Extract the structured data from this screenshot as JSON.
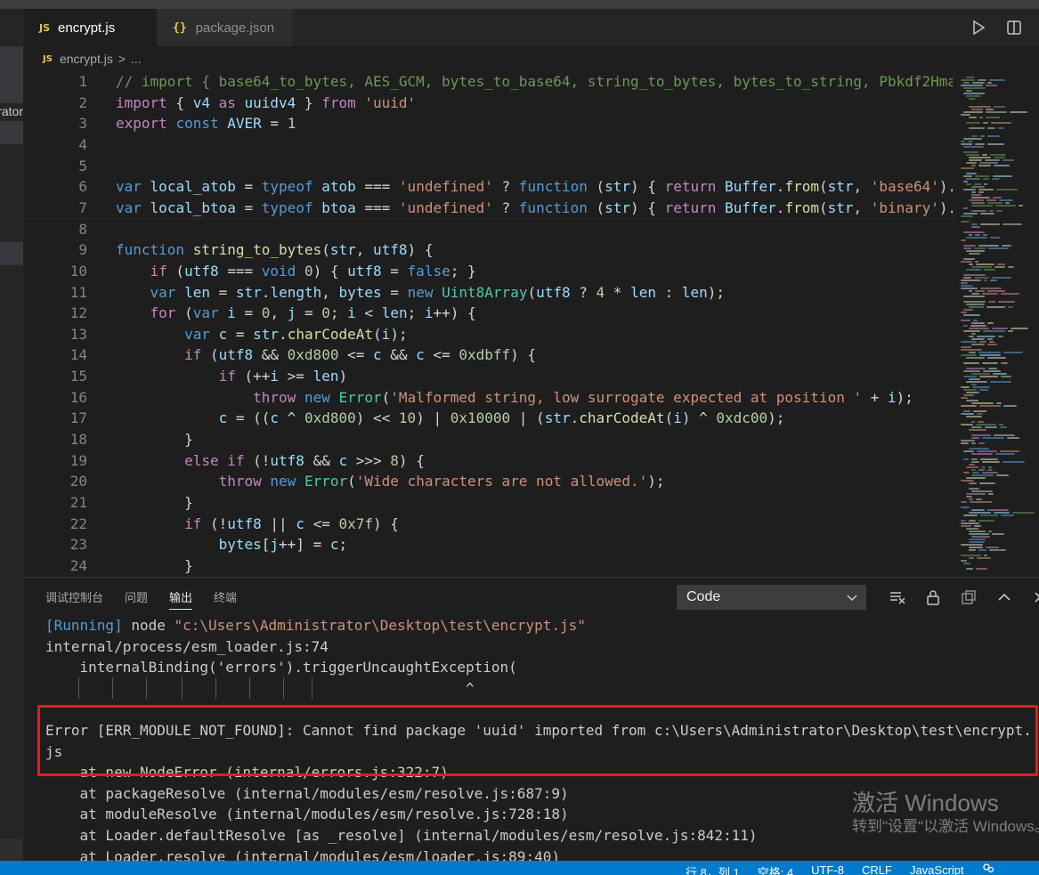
{
  "tabs": [
    {
      "badge": "JS",
      "label": "encrypt.js",
      "active": true
    },
    {
      "badge": "{}",
      "label": "package.json",
      "active": false
    }
  ],
  "tab_actions": [
    {
      "icon": "run-icon"
    },
    {
      "icon": "split-editor-icon"
    }
  ],
  "sidebar": {
    "partial_label": "rator"
  },
  "breadcrumb": {
    "badge": "JS",
    "file": "encrypt.js",
    "separator": ">",
    "rest": "..."
  },
  "editor": {
    "lines": [
      "1",
      "2",
      "3",
      "4",
      "5",
      "6",
      "7",
      "8",
      "9",
      "10",
      "11",
      "12",
      "13",
      "14",
      "15",
      "16",
      "17",
      "18",
      "19",
      "20",
      "21",
      "22",
      "23",
      "24"
    ]
  },
  "panel": {
    "tabs": [
      "调试控制台",
      "问题",
      "输出",
      "终端"
    ],
    "active_tab": "输出",
    "output_channel": "Code",
    "icons": [
      "clear-output-icon",
      "lock-icon",
      "open-editor-icon",
      "maximize-icon",
      "close-icon"
    ],
    "output_lines": {
      "running_tag": "[Running]",
      "running_cmd": " node ",
      "running_path": "\"c:\\Users\\Administrator\\Desktop\\test\\encrypt.js\"",
      "l2": "internal/process/esm_loader.js:74",
      "l3": "    internalBinding('errors').triggerUncaughtException(",
      "l4": "                                                 ^",
      "l5": "",
      "l6": "Error [ERR_MODULE_NOT_FOUND]: Cannot find package 'uuid' imported from c:\\Users\\Administrator\\Desktop\\test\\encrypt.",
      "l7": "js",
      "l8": "    at new NodeError (internal/errors.js:322:7)",
      "l9": "    at packageResolve (internal/modules/esm/resolve.js:687:9)",
      "l10": "    at moduleResolve (internal/modules/esm/resolve.js:728:18)",
      "l11": "    at Loader.defaultResolve [as _resolve] (internal/modules/esm/resolve.js:842:11)",
      "l12": "    at Loader.resolve (internal/modules/esm/loader.js:89:40)"
    }
  },
  "watermark": {
    "line1": "激活 Windows",
    "line2": "转到\"设置\"以激活 Windows。"
  },
  "statusbar": {
    "items": [
      "行 8，列 1",
      "空格: 4",
      "UTF-8",
      "CRLF",
      "JavaScript"
    ]
  },
  "colors": {
    "accent": "#007acc",
    "error_box": "#e51d1d",
    "editor_bg": "#1e1e1e"
  }
}
